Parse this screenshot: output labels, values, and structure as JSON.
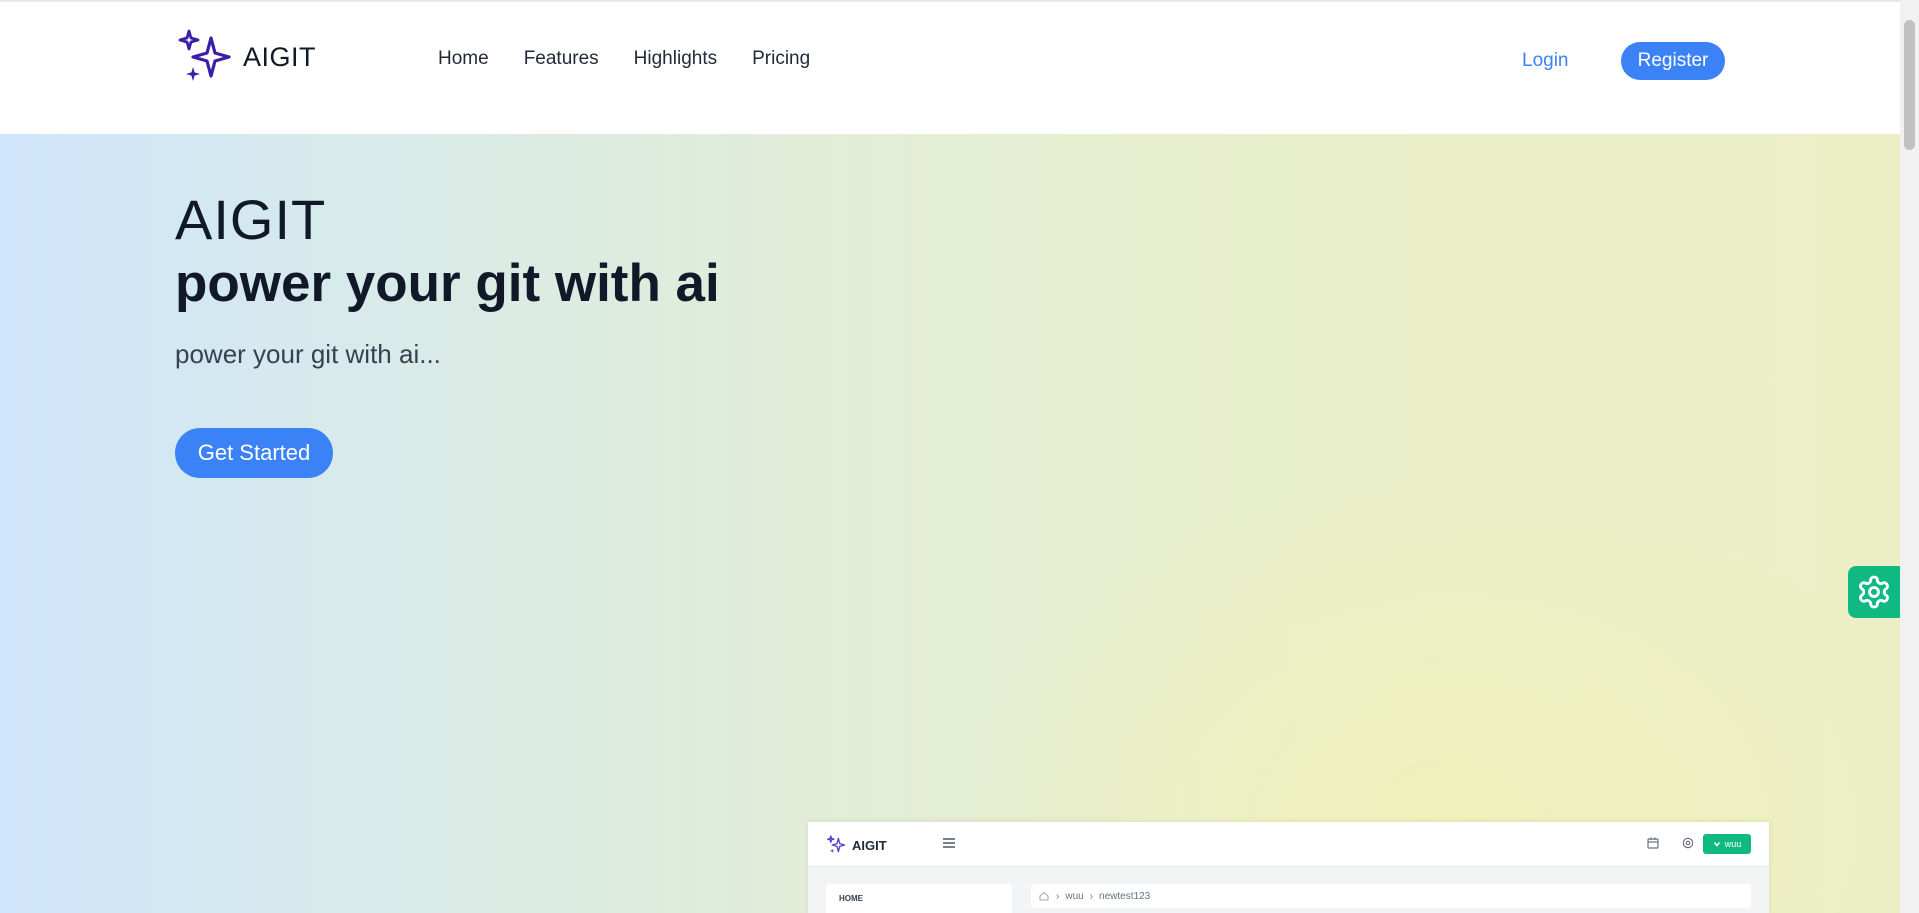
{
  "header": {
    "logo_text": "AIGIT",
    "nav": [
      {
        "label": "Home"
      },
      {
        "label": "Features"
      },
      {
        "label": "Highlights"
      },
      {
        "label": "Pricing"
      }
    ],
    "login_label": "Login",
    "register_label": "Register"
  },
  "hero": {
    "title_light": "AIGIT",
    "title_bold": "power your git with ai",
    "subtitle": "power your git with ai...",
    "cta_label": "Get Started"
  },
  "preview": {
    "logo_text": "AIGIT",
    "user_label": "wuu",
    "sidebar_home": "HOME",
    "breadcrumb": [
      "wuu",
      "newtest123"
    ]
  },
  "colors": {
    "primary": "#3b82f6",
    "accent_green": "#10b981",
    "logo_purple": "#3b1fa6"
  },
  "icons": {
    "logo": "sparkles-icon",
    "settings": "gear-icon",
    "menu": "hamburger-icon",
    "calendar": "calendar-icon",
    "home": "home-icon",
    "chevron": "chevron-down-icon"
  }
}
